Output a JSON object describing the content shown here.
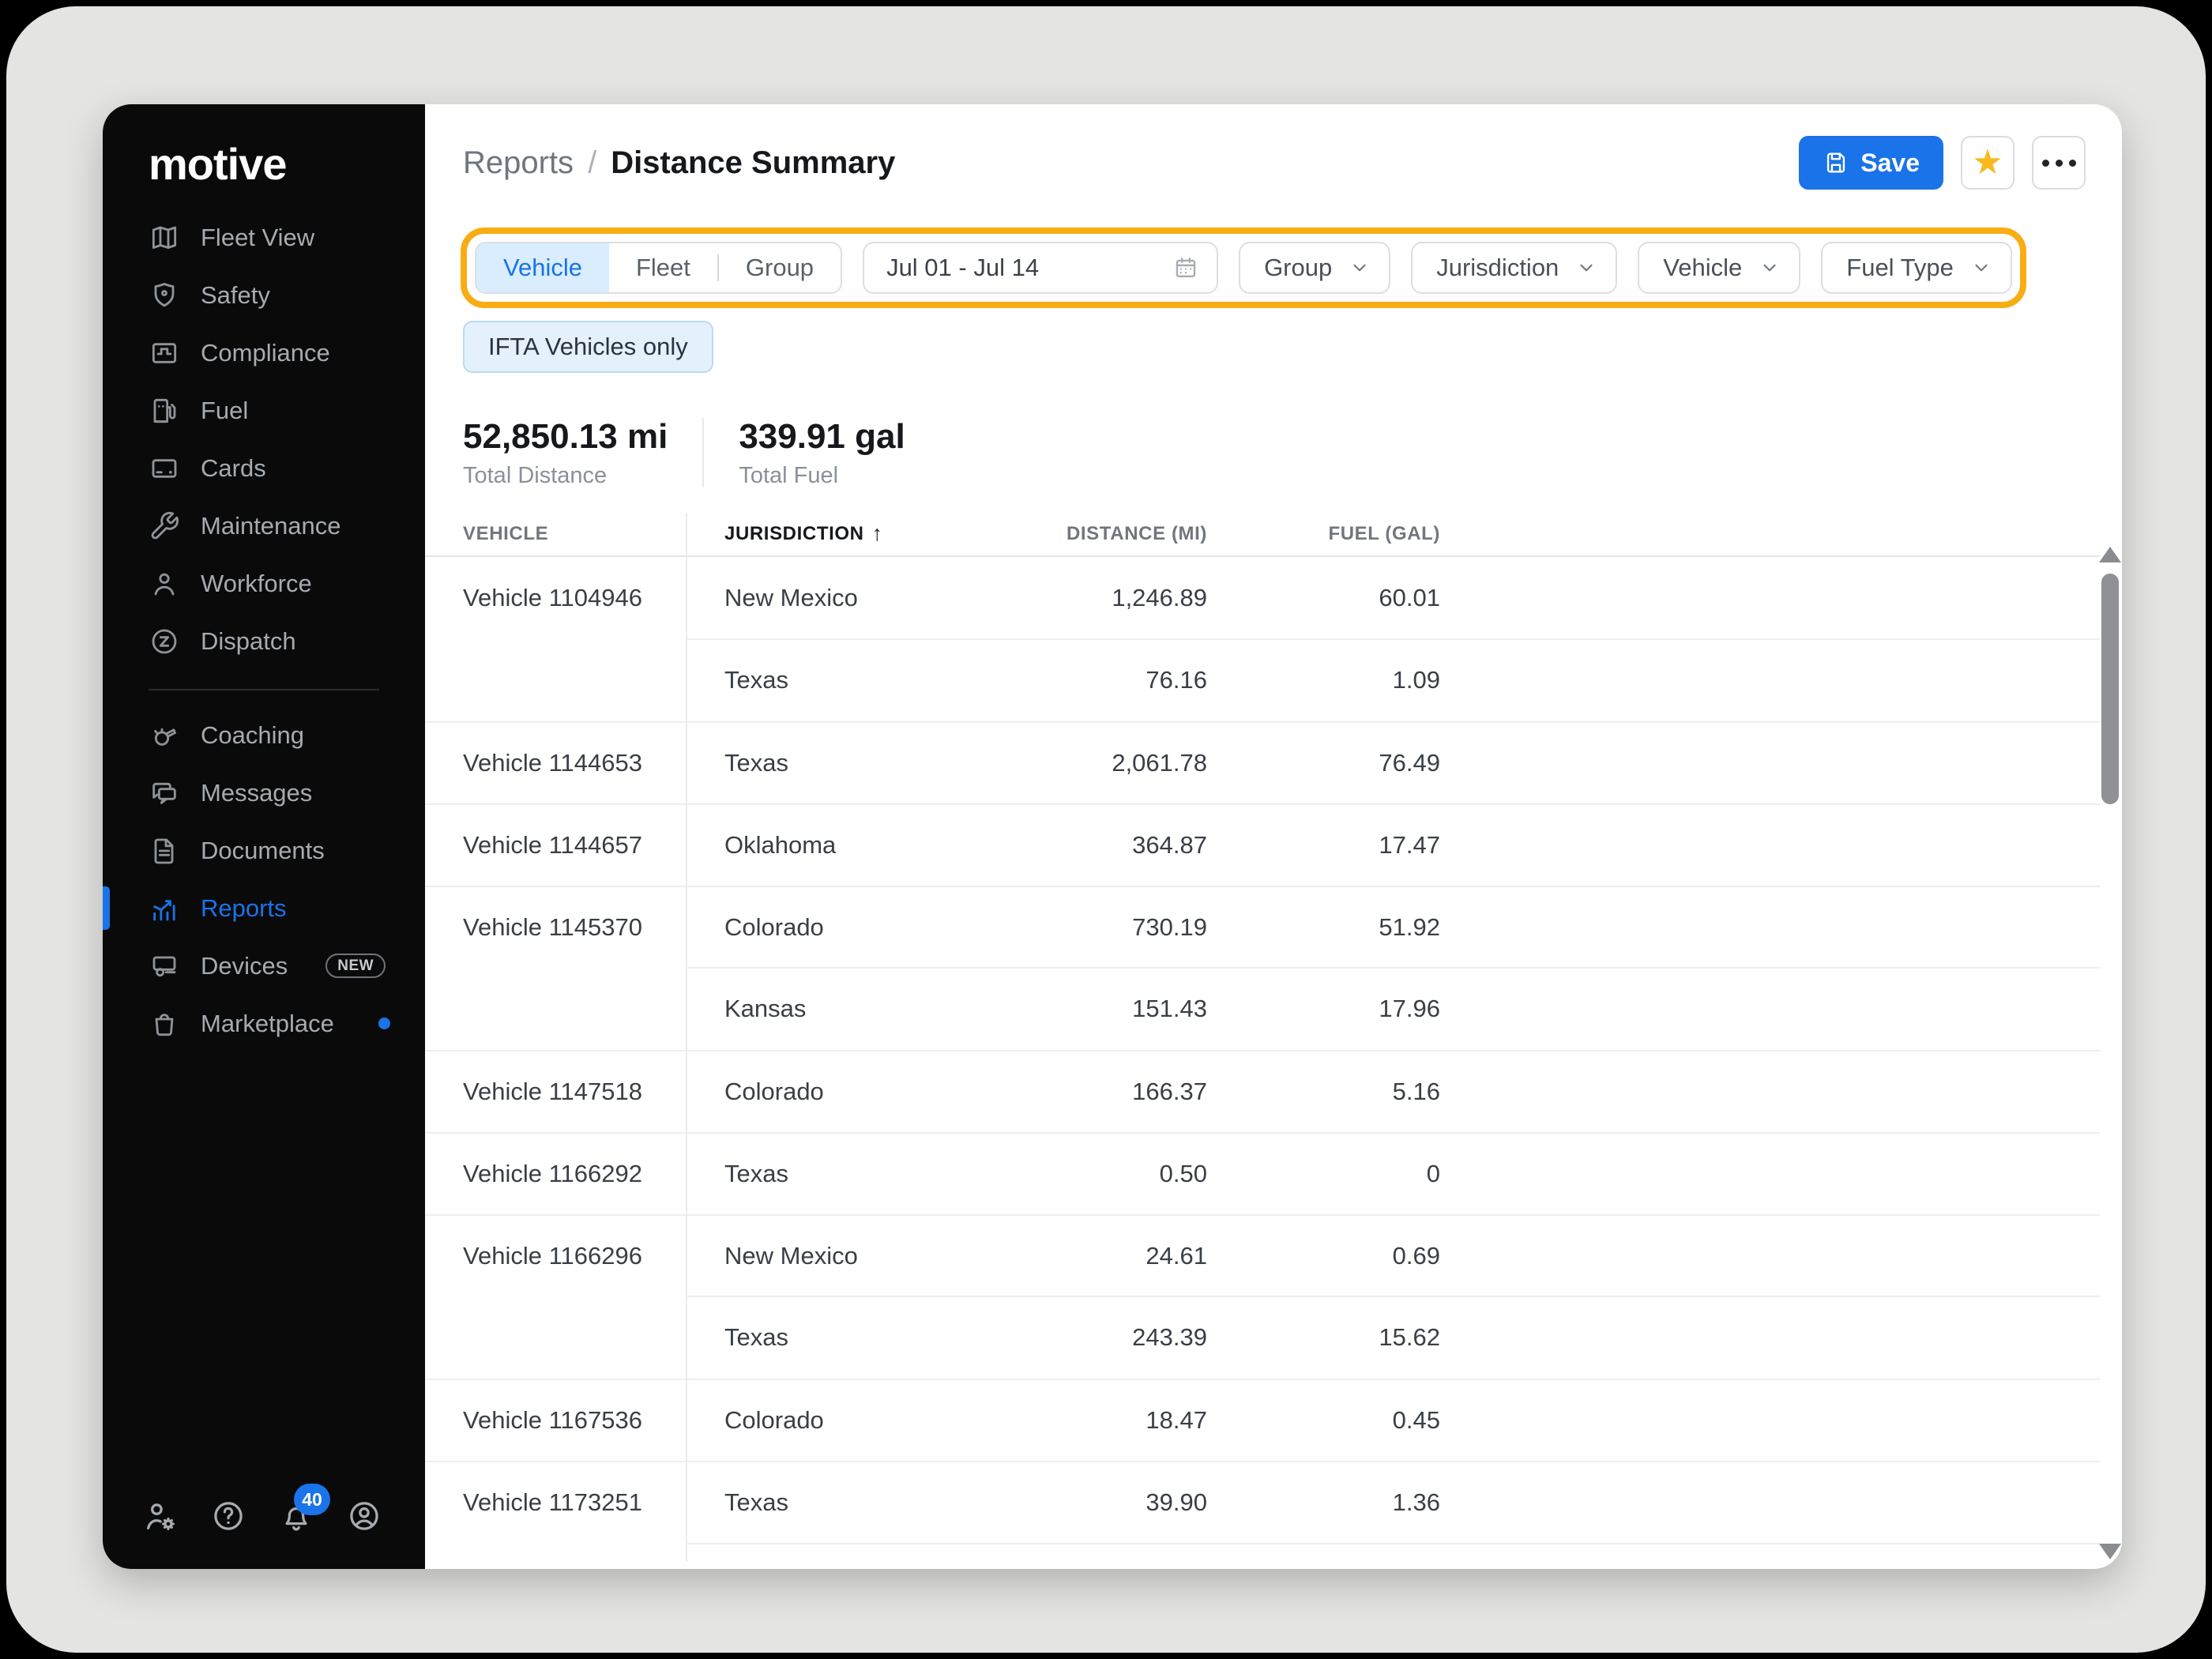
{
  "colors": {
    "accent": "#1A73E8",
    "highlight_ring": "#F8AD15",
    "sidebar_bg": "#0A0A0B",
    "star": "#F9B81E",
    "selected_tab_bg": "#D9EDFE",
    "chip_bg": "#E4F1FC",
    "page_bg": "#E4E4E2"
  },
  "sidebar": {
    "logo": "motive",
    "sections": [
      {
        "items": [
          {
            "label": "Fleet View",
            "icon": "map-icon"
          },
          {
            "label": "Safety",
            "icon": "shield-icon"
          },
          {
            "label": "Compliance",
            "icon": "compliance-icon"
          },
          {
            "label": "Fuel",
            "icon": "fuel-pump-icon"
          },
          {
            "label": "Cards",
            "icon": "credit-card-icon"
          },
          {
            "label": "Maintenance",
            "icon": "wrench-icon"
          },
          {
            "label": "Workforce",
            "icon": "person-icon"
          },
          {
            "label": "Dispatch",
            "icon": "dispatch-icon"
          }
        ]
      },
      {
        "items": [
          {
            "label": "Coaching",
            "icon": "whistle-icon"
          },
          {
            "label": "Messages",
            "icon": "messages-icon"
          },
          {
            "label": "Documents",
            "icon": "document-icon"
          },
          {
            "label": "Reports",
            "icon": "reports-icon",
            "active": true
          },
          {
            "label": "Devices",
            "icon": "devices-icon",
            "badge": "NEW"
          },
          {
            "label": "Marketplace",
            "icon": "marketplace-icon",
            "dot": true
          }
        ]
      }
    ],
    "footer_icons": [
      {
        "name": "user-settings-icon"
      },
      {
        "name": "help-icon"
      },
      {
        "name": "notifications-icon",
        "badge": "40"
      },
      {
        "name": "profile-icon"
      }
    ]
  },
  "header": {
    "breadcrumb_parent": "Reports",
    "breadcrumb_separator": "/",
    "title": "Distance Summary",
    "save_label": "Save"
  },
  "filters": {
    "view_tabs": [
      {
        "label": "Vehicle",
        "active": true
      },
      {
        "label": "Fleet"
      },
      {
        "label": "Group"
      }
    ],
    "date_range": "Jul 01 - Jul 14",
    "dropdowns": [
      {
        "label": "Group"
      },
      {
        "label": "Jurisdiction"
      },
      {
        "label": "Vehicle"
      },
      {
        "label": "Fuel Type"
      }
    ],
    "toggle_chip": "IFTA Vehicles only"
  },
  "summary": {
    "total_distance_value": "52,850.13 mi",
    "total_distance_label": "Total Distance",
    "total_fuel_value": "339.91 gal",
    "total_fuel_label": "Total Fuel"
  },
  "table": {
    "columns": [
      {
        "label": "VEHICLE"
      },
      {
        "label": "JURISDICTION",
        "sorted": "asc"
      },
      {
        "label": "DISTANCE (MI)",
        "align": "right"
      },
      {
        "label": "FUEL (GAL)",
        "align": "right"
      }
    ],
    "rows": [
      {
        "vehicle": "Vehicle 1104946",
        "jurisdiction": "New Mexico",
        "distance": "1,246.89",
        "fuel": "60.01",
        "group_start": true
      },
      {
        "vehicle": "",
        "jurisdiction": "Texas",
        "distance": "76.16",
        "fuel": "1.09",
        "group_start": false
      },
      {
        "vehicle": "Vehicle 1144653",
        "jurisdiction": "Texas",
        "distance": "2,061.78",
        "fuel": "76.49",
        "group_start": true
      },
      {
        "vehicle": "Vehicle 1144657",
        "jurisdiction": "Oklahoma",
        "distance": "364.87",
        "fuel": "17.47",
        "group_start": true
      },
      {
        "vehicle": "Vehicle 1145370",
        "jurisdiction": "Colorado",
        "distance": "730.19",
        "fuel": "51.92",
        "group_start": true
      },
      {
        "vehicle": "",
        "jurisdiction": "Kansas",
        "distance": "151.43",
        "fuel": "17.96",
        "group_start": false
      },
      {
        "vehicle": "Vehicle 1147518",
        "jurisdiction": "Colorado",
        "distance": "166.37",
        "fuel": "5.16",
        "group_start": true
      },
      {
        "vehicle": "Vehicle 1166292",
        "jurisdiction": "Texas",
        "distance": "0.50",
        "fuel": "0",
        "group_start": true
      },
      {
        "vehicle": "Vehicle 1166296",
        "jurisdiction": "New Mexico",
        "distance": "24.61",
        "fuel": "0.69",
        "group_start": true
      },
      {
        "vehicle": "",
        "jurisdiction": "Texas",
        "distance": "243.39",
        "fuel": "15.62",
        "group_start": false
      },
      {
        "vehicle": "Vehicle 1167536",
        "jurisdiction": "Colorado",
        "distance": "18.47",
        "fuel": "0.45",
        "group_start": true
      },
      {
        "vehicle": "Vehicle 1173251",
        "jurisdiction": "Texas",
        "distance": "39.90",
        "fuel": "1.36",
        "group_start": true
      }
    ]
  }
}
